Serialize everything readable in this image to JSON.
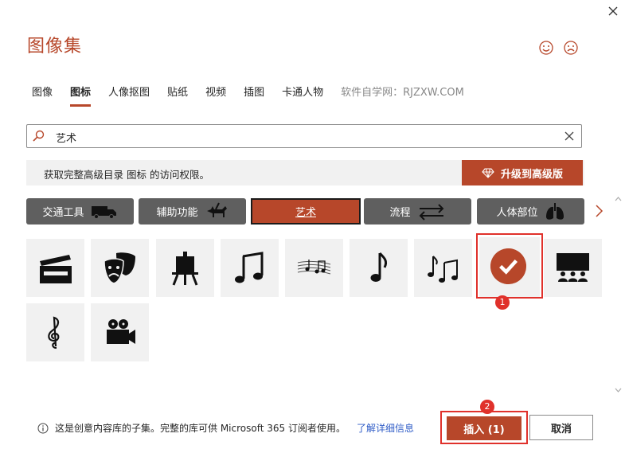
{
  "window": {
    "title": "图像集"
  },
  "tabs": [
    {
      "label": "图像"
    },
    {
      "label": "图标"
    },
    {
      "label": "人像抠图"
    },
    {
      "label": "贴纸"
    },
    {
      "label": "视频"
    },
    {
      "label": "插图"
    },
    {
      "label": "卡通人物"
    },
    {
      "label": "软件自学网：RJZXW.COM"
    }
  ],
  "search": {
    "value": "艺术"
  },
  "banner": {
    "text": "获取完整高级目录 图标 的访问权限。",
    "upgrade_label": "升级到高级版"
  },
  "categories": [
    {
      "label": "交通工具",
      "icon": "truck-icon"
    },
    {
      "label": "辅助功能",
      "icon": "guide-dog-icon"
    },
    {
      "label": "艺术",
      "icon": ""
    },
    {
      "label": "流程",
      "icon": "swap-arrows-icon"
    },
    {
      "label": "人体部位",
      "icon": "lungs-icon"
    }
  ],
  "icons": [
    {
      "name": "clapperboard-icon"
    },
    {
      "name": "theater-masks-icon"
    },
    {
      "name": "easel-icon"
    },
    {
      "name": "music-notes-icon"
    },
    {
      "name": "sheet-music-icon"
    },
    {
      "name": "eighth-note-icon"
    },
    {
      "name": "music-notes-2-icon"
    },
    {
      "name": "palette-icon",
      "selected": true
    },
    {
      "name": "audience-icon"
    },
    {
      "name": "treble-clef-icon"
    },
    {
      "name": "movie-camera-icon"
    }
  ],
  "badges": {
    "first": "1",
    "second": "2"
  },
  "footer": {
    "info": "这是创意内容库的子集。完整的库可供 Microsoft 365 订阅者使用。",
    "link": "了解详细信息"
  },
  "buttons": {
    "insert": "插入 (1)",
    "cancel": "取消"
  },
  "colors": {
    "accent": "#b7472a",
    "highlight": "#e0312b",
    "category_bg": "#5f5f5f",
    "tile_bg": "#f1f1f1"
  }
}
